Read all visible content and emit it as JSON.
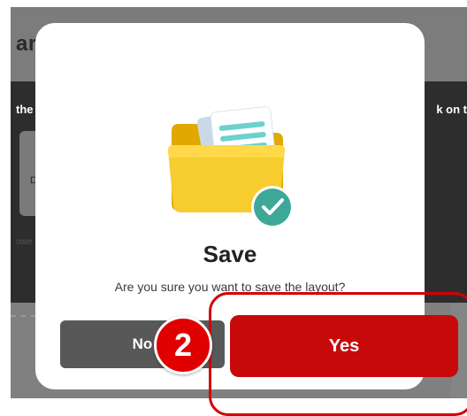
{
  "background": {
    "header_title": "arc",
    "left_text": "the",
    "right_text": "k on t",
    "card_text": "D",
    "faint_text": "owe"
  },
  "dialog": {
    "title": "Save",
    "message": "Are you sure you want to save the layout?",
    "no_label": "No",
    "yes_label": "Yes",
    "illustration_icon": "folder-with-checkmark-icon"
  },
  "tutorial": {
    "step_number": "2"
  },
  "colors": {
    "primary_red": "#c8090a",
    "secondary_gray": "#585858",
    "check_teal": "#3ea898",
    "folder_yellow": "#f5c518"
  }
}
